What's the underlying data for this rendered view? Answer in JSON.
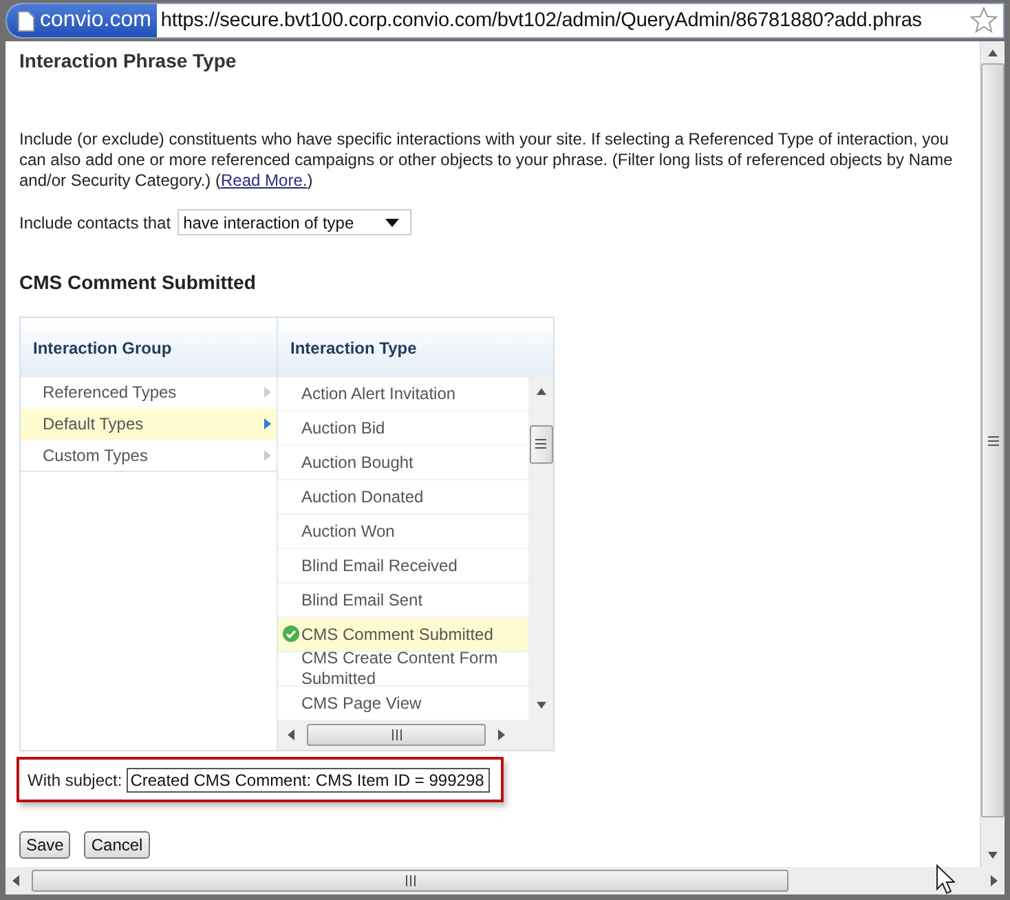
{
  "browser": {
    "site_badge": "convio.com",
    "url": "https://secure.bvt100.corp.convio.com/bvt102/admin/QueryAdmin/86781880?add.phras"
  },
  "page_title": "Interaction Phrase Type",
  "description": {
    "before": "Include (or exclude) constituents who have specific interactions with your site. If selecting a Referenced Type of interaction, you can also add one or more referenced campaigns or other objects to your phrase. (Filter long lists of referenced objects by Name and/or Security Category.) (",
    "link": "Read More.",
    "after": ")"
  },
  "include": {
    "label": "Include contacts that",
    "value": "have interaction of type"
  },
  "section_title": "CMS Comment Submitted",
  "columns": [
    "Interaction Group",
    "Interaction Type"
  ],
  "groups": [
    {
      "label": "Referenced Types",
      "selected": false
    },
    {
      "label": "Default Types",
      "selected": true
    },
    {
      "label": "Custom Types",
      "selected": false
    }
  ],
  "types": [
    {
      "label": "Action Alert Invitation",
      "selected": false
    },
    {
      "label": "Auction Bid",
      "selected": false
    },
    {
      "label": "Auction Bought",
      "selected": false
    },
    {
      "label": "Auction Donated",
      "selected": false
    },
    {
      "label": "Auction Won",
      "selected": false
    },
    {
      "label": "Blind Email Received",
      "selected": false
    },
    {
      "label": "Blind Email Sent",
      "selected": false
    },
    {
      "label": "CMS Comment Submitted",
      "selected": true
    },
    {
      "label": "CMS Create Content Form Submitted",
      "selected": false
    },
    {
      "label": "CMS Page View",
      "selected": false
    }
  ],
  "subject": {
    "label": "With subject:",
    "value": "Created CMS Comment: CMS Item ID = 999298"
  },
  "buttons": [
    "Save",
    "Cancel"
  ]
}
